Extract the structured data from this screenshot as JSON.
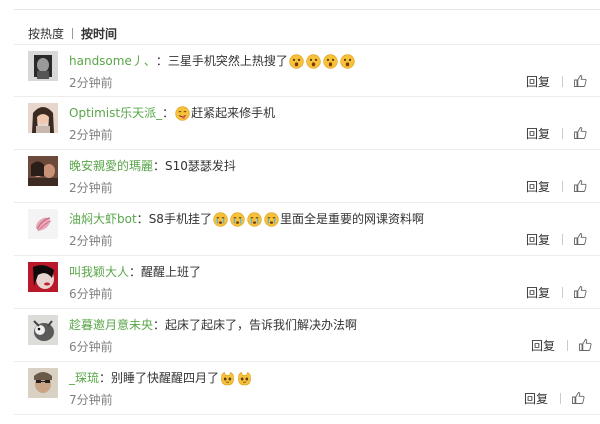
{
  "sort": {
    "by_heat": "按热度",
    "by_time": "按时间"
  },
  "comments": [
    {
      "username": "handsome丿、",
      "separator": "：",
      "text": "三星手机突然上热搜了",
      "emojis": [
        "shocked-face-icon",
        "shocked-face-icon",
        "shocked-face-icon",
        "shocked-face-icon"
      ],
      "time": "2分钟前",
      "reply": "回复"
    },
    {
      "username": "Optimist乐天派_",
      "separator": "：",
      "text_before": "",
      "text": "赶紧起来修手机",
      "emojis_before": [
        "tongue-face-icon"
      ],
      "time": "2分钟前",
      "reply": "回复"
    },
    {
      "username": "晚安親愛的瑪麗",
      "separator": "：",
      "text": "S10瑟瑟发抖",
      "time": "2分钟前",
      "reply": "回复"
    },
    {
      "username": "油焖大虾bot",
      "separator": "：",
      "text": "S8手机挂了",
      "emojis": [
        "crying-face-icon",
        "crying-face-icon",
        "crying-face-icon",
        "crying-face-icon"
      ],
      "text_after": "里面全是重要的网课资料啊",
      "time": "2分钟前",
      "reply": "回复"
    },
    {
      "username": "叫我颖大人",
      "separator": "：",
      "text": "醒醒上班了",
      "time": "6分钟前",
      "reply": "回复"
    },
    {
      "username": "趁暮邀月意未央",
      "separator": "：",
      "text": "起床了起床了，告诉我们解决办法啊",
      "time": "6分钟前",
      "reply": "回复"
    },
    {
      "username": "_琛琉",
      "separator": "：",
      "text": "别睡了快醒醒四月了",
      "emojis": [
        "cat-face-icon",
        "cat-face-icon"
      ],
      "time": "7分钟前",
      "reply": "回复"
    }
  ],
  "colors": {
    "username": "#5aa64a",
    "time": "#808080",
    "divider": "#ececec"
  }
}
